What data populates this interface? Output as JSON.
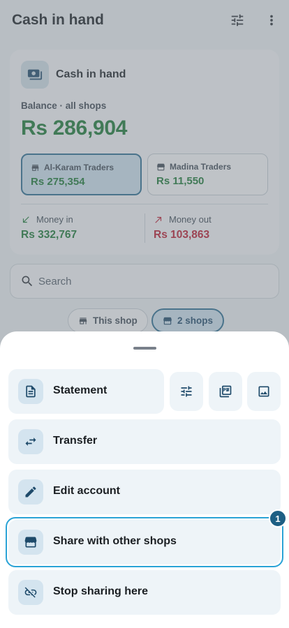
{
  "app_bar": {
    "title": "Cash in hand",
    "icons": [
      "tune-icon",
      "more-vert-icon"
    ]
  },
  "summary": {
    "title": "Cash in hand",
    "balance_label": "Balance · all shops",
    "balance": "Rs 286,904",
    "shops": [
      {
        "name": "Al-Karam Traders",
        "amount": "Rs 275,354",
        "selected": true
      },
      {
        "name": "Madina Traders",
        "amount": "Rs 11,550",
        "selected": false
      }
    ],
    "money_in_label": "Money in",
    "money_in": "Rs 332,767",
    "money_out_label": "Money out",
    "money_out": "Rs 103,863"
  },
  "search": {
    "placeholder": "Search",
    "value": ""
  },
  "scope": {
    "this_shop": "This shop",
    "two_shops": "2 shops",
    "selected": "2 shops"
  },
  "sheet": {
    "actions": {
      "statement": "Statement",
      "transfer": "Transfer",
      "edit": "Edit account",
      "share": "Share with other shops",
      "stop": "Stop sharing here"
    },
    "highlight_badge": "1"
  },
  "colors": {
    "positive": "#1b7a33",
    "negative": "#c0192c",
    "accent": "#1d5f84",
    "highlight": "#2aa3d6"
  }
}
